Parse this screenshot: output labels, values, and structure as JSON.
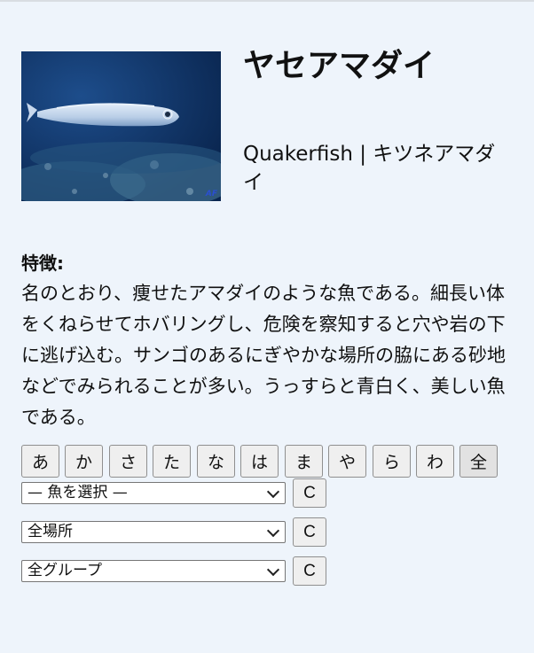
{
  "fish": {
    "name": "ヤセアマダイ",
    "subtitle": "Quakerfish | キツネアマダイ",
    "photo_mark": "AF",
    "features_label": "特徴:",
    "description": "名のとおり、痩せたアマダイのような魚である。細長い体をくねらせてホバリングし、危険を察知すると穴や岩の下に逃げ込む。サンゴのあるにぎやかな場所の脇にある砂地などでみられることが多い。うっすらと青白く、美しい魚である。"
  },
  "kana_buttons": [
    "あ",
    "か",
    "さ",
    "た",
    "な",
    "は",
    "ま",
    "や",
    "ら",
    "わ",
    "全"
  ],
  "selects": [
    {
      "value": "— 魚を選択 —",
      "clear_label": "C"
    },
    {
      "value": "全場所",
      "clear_label": "C"
    },
    {
      "value": "全グループ",
      "clear_label": "C"
    }
  ],
  "colors": {
    "background": "#eef4fb",
    "button_bg": "#efefef",
    "photo_water": "#163f76"
  }
}
